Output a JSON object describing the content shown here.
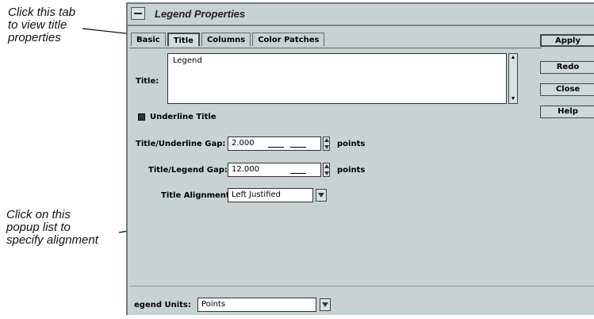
{
  "callouts": {
    "tab_note": "Click this tab\nto view title\nproperties",
    "popup_note": "Click on this\npopup list to\nspecify alignment"
  },
  "window": {
    "title": "Legend Properties"
  },
  "tabs": [
    {
      "label": "Basic"
    },
    {
      "label": "Title"
    },
    {
      "label": "Columns"
    },
    {
      "label": "Color Patches"
    }
  ],
  "active_tab": "Title",
  "side_buttons": {
    "apply": "Apply",
    "redo": "Redo",
    "close": "Close",
    "help": "Help"
  },
  "title_section": {
    "label": "Title:",
    "value": "Legend"
  },
  "underline": {
    "label": "Underline Title",
    "checked": true
  },
  "title_underline_gap": {
    "label": "Title/Underline Gap:",
    "value": "2.000",
    "units": "points"
  },
  "title_legend_gap": {
    "label": "Title/Legend Gap:",
    "value": "12.000",
    "units": "points"
  },
  "title_alignment": {
    "label": "Title Alignment:",
    "value": "Left Justified"
  },
  "legend_units": {
    "label": "egend Units:",
    "value": "Points"
  },
  "colors": {
    "panel": "#c7d2d2",
    "field": "#ffffff"
  }
}
